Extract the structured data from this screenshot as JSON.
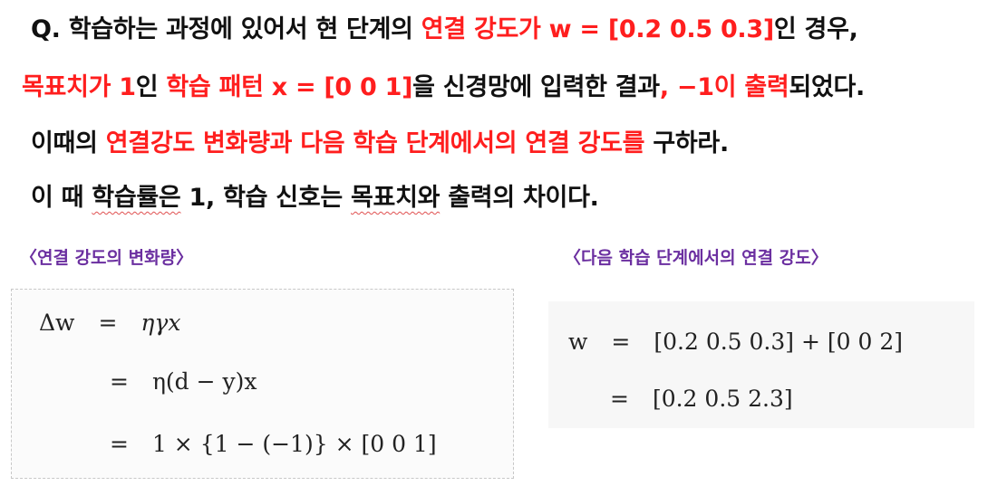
{
  "question": {
    "line1": {
      "p1": "Q. 학습하는 과정에 있어서 현 단계의 ",
      "p2": "연결 강도가 w = [0.2 0.5 0.3]",
      "p3": "인 경우,"
    },
    "line2": {
      "p1": "목표치가 1",
      "p2": "인 ",
      "p3": "학습 패턴 x = [0 0 1]",
      "p4": "을 신경망에 입력한 결과",
      "p5": ", −1이 출력",
      "p6": "되었다."
    },
    "line3": {
      "p1": "이때의 ",
      "p2": "연결강도 변화량과 다음 학습 단계에서의 연결 강도를",
      "p3": " 구하라."
    },
    "line4": {
      "p1": "이 때 ",
      "p2": "학습률은",
      "p3": " 1, 학습 신호는 ",
      "p4": "목표치와",
      "p5": " 출력의 차이다."
    }
  },
  "headings": {
    "left": "〈연결 강도의 변화량〉",
    "right": "〈다음 학습 단계에서의 연결 강도〉"
  },
  "left_equation": {
    "row1": {
      "lhs": "Δw",
      "op": "=",
      "rhs": "ηγx"
    },
    "row2": {
      "op": "=",
      "rhs": "η(d − y)x"
    },
    "row3": {
      "op": "=",
      "rhs": "1 × {1 − (−1)} × [0 0 1]"
    }
  },
  "right_equation": {
    "row1": {
      "lhs": "w",
      "op": "=",
      "rhs": "[0.2 0.5 0.3] + [0 0 2]"
    },
    "row2": {
      "op": "=",
      "rhs": "[0.2 0.5 2.3]"
    }
  },
  "colors": {
    "highlight": "#ff1e1e",
    "heading": "#6b2fa0",
    "text": "#111111"
  }
}
